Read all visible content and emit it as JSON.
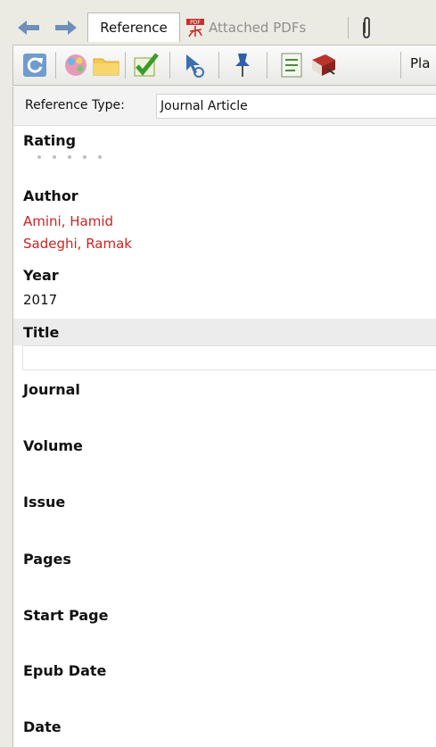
{
  "tabs": {
    "reference": "Reference",
    "attached_pdfs": "Attached PDFs"
  },
  "toolbar": {
    "overflow_text": "Pla"
  },
  "reference_type": {
    "label": "Reference Type:",
    "value": "Journal Article"
  },
  "fields": {
    "rating": {
      "label": "Rating",
      "stars": 0,
      "max_stars": 5
    },
    "author": {
      "label": "Author",
      "values": [
        "Amini, Hamid",
        "Sadeghi, Ramak"
      ]
    },
    "year": {
      "label": "Year",
      "value": "2017"
    },
    "title": {
      "label": "Title",
      "value": ""
    },
    "journal": {
      "label": "Journal"
    },
    "volume": {
      "label": "Volume"
    },
    "issue": {
      "label": "Issue"
    },
    "pages": {
      "label": "Pages"
    },
    "start_page": {
      "label": "Start Page"
    },
    "epub_date": {
      "label": "Epub Date"
    },
    "date": {
      "label": "Date"
    }
  },
  "colors": {
    "author_text": "#cc2222",
    "window_bg": "#ecebe3",
    "panel_bg": "#ffffff"
  },
  "icons": [
    "back-arrow-icon",
    "forward-arrow-icon",
    "pdf-icon",
    "paperclip-icon",
    "refresh-icon",
    "color-palette-icon",
    "folder-icon",
    "checkmark-icon",
    "cursor-icon",
    "pushpin-icon",
    "list-icon",
    "book-edit-icon"
  ]
}
